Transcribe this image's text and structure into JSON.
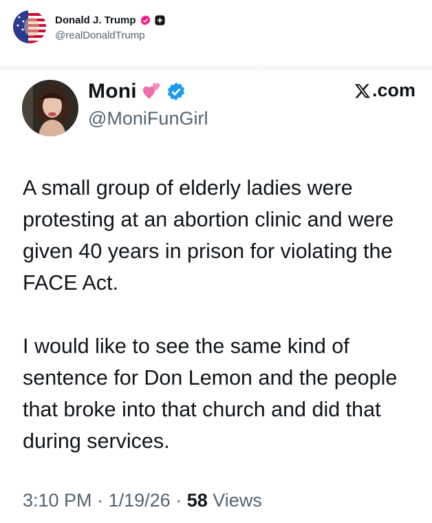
{
  "poster": {
    "name": "Donald J. Trump",
    "handle": "@realDonaldTrump",
    "avatar_icon": "flag-portrait-avatar",
    "badge_icon": "verified-badge-icon",
    "badge_color": "#f91880",
    "extra_icon": "plus-square-icon"
  },
  "quoted": {
    "name": "Moni",
    "name_emoji": "two-hearts-icon",
    "handle": "@MoniFunGirl",
    "badge_icon": "verified-badge-icon",
    "badge_color": "#1d9bf0",
    "site": ".com",
    "paragraphs": [
      "A small group of elderly ladies were protesting at an abortion clinic and were given 40 years in prison for violating the FACE Act.",
      "I would like to see the same kind of sentence for Don Lemon and the people that broke into that church and did that during services."
    ],
    "time": "3:10 PM",
    "date": "1/19/26",
    "separator": "·",
    "views_count": "58",
    "views_label": "Views"
  }
}
